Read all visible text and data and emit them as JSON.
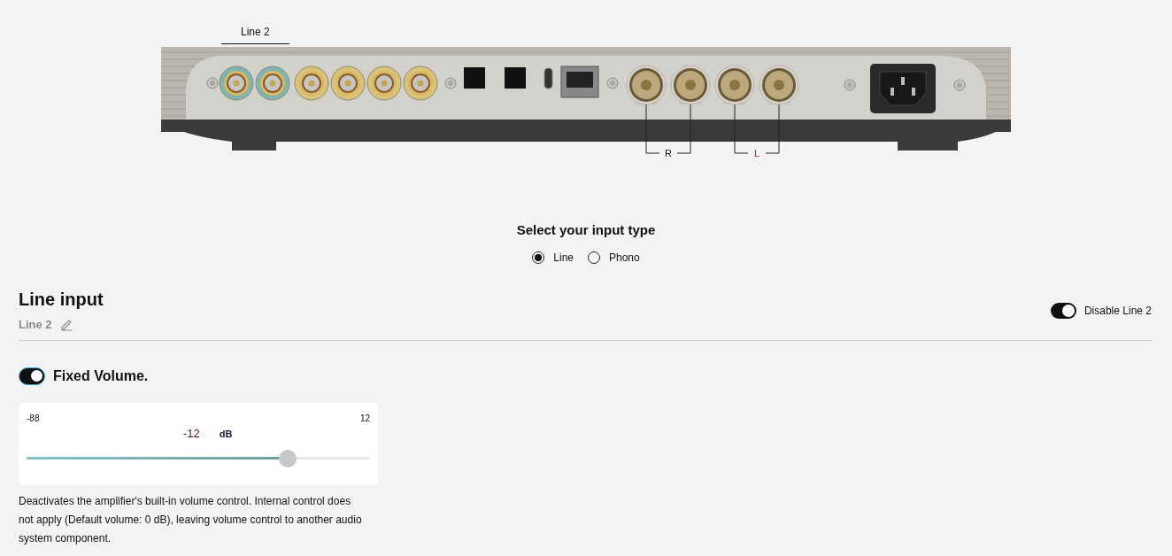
{
  "device": {
    "tab_label": "Line 2",
    "channel_labels": [
      "R",
      "L"
    ]
  },
  "input_type": {
    "title": "Select your input type",
    "options": [
      {
        "label": "Line",
        "selected": true
      },
      {
        "label": "Phono",
        "selected": false
      }
    ]
  },
  "line_input": {
    "title": "Line input",
    "name": "Line 2",
    "disable_toggle": {
      "label": "Disable Line 2",
      "on": true
    }
  },
  "fixed_volume": {
    "label": "Fixed Volume.",
    "on": true,
    "slider": {
      "min": "-88",
      "max": "12",
      "value": "-12",
      "unit": "dB",
      "level": 0.76
    },
    "description": "Deactivates the amplifier's built-in volume control. Internal control does not apply (Default volume: 0 dB), leaving volume control to another audio system component."
  }
}
